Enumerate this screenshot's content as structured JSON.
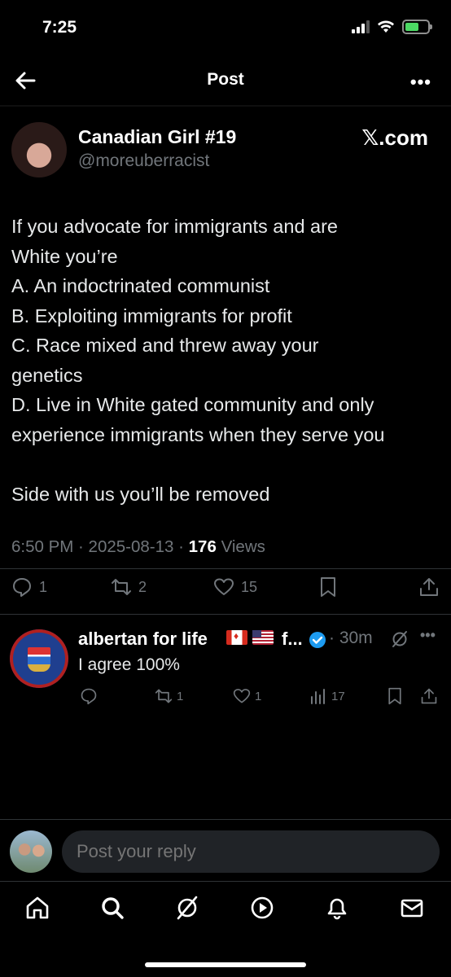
{
  "status_bar": {
    "time": "7:25"
  },
  "header": {
    "title": "Post",
    "more": "•••"
  },
  "post": {
    "author_name": "Canadian Girl #19",
    "author_handle": "@moreuberracist",
    "source_label": "𝕏.com",
    "text_lines": [
      "If you advocate for immigrants and are",
      "White you’re",
      "A. An indoctrinated communist",
      "B. Exploiting immigrants for profit",
      "C. Race mixed and threw away your",
      "genetics",
      "D. Live in White gated community and only",
      "experience immigrants when they serve you",
      "",
      "Side with us you’ll be removed"
    ],
    "meta_time": "6:50 PM · 2025-08-13 · ",
    "views_count": "176",
    "views_label": " Views",
    "reply_count": "1",
    "repost_count": "2",
    "like_count": "15"
  },
  "reply": {
    "name": "albertan for life",
    "name_trunc": "f...",
    "time": "· 30m",
    "more": "•••",
    "text": "I agree 100%",
    "reply_count": "",
    "repost_count": "1",
    "like_count": "1",
    "views_count": "17"
  },
  "composer": {
    "placeholder": "Post your reply"
  },
  "colors": {
    "accent": "#1d9bf0",
    "muted": "#71767b",
    "background": "#000000"
  }
}
